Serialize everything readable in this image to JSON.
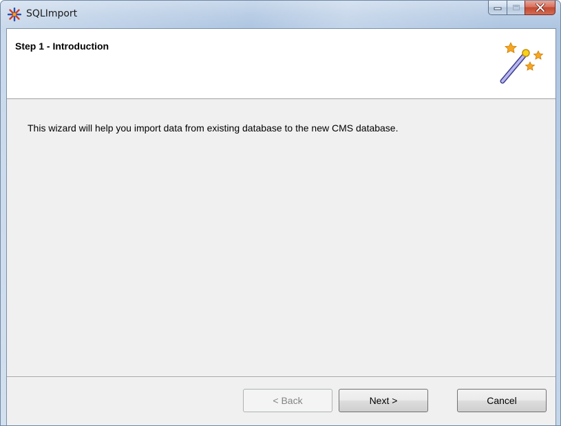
{
  "window": {
    "title": "SQLImport"
  },
  "header": {
    "step_title": "Step 1 - Introduction"
  },
  "content": {
    "intro_text": "This wizard will help you import data from existing database to the new CMS database."
  },
  "buttons": {
    "back_label": "< Back",
    "back_enabled": false,
    "next_label": "Next >",
    "cancel_label": "Cancel"
  },
  "icons": {
    "app": "snowflake-app-icon",
    "header": "magic-wand-icon",
    "minimize": "minimize-icon",
    "maximize": "maximize-icon",
    "close": "close-icon"
  },
  "colors": {
    "client_background": "#f0f0f0",
    "header_background": "#ffffff",
    "close_button": "#c24a33"
  }
}
